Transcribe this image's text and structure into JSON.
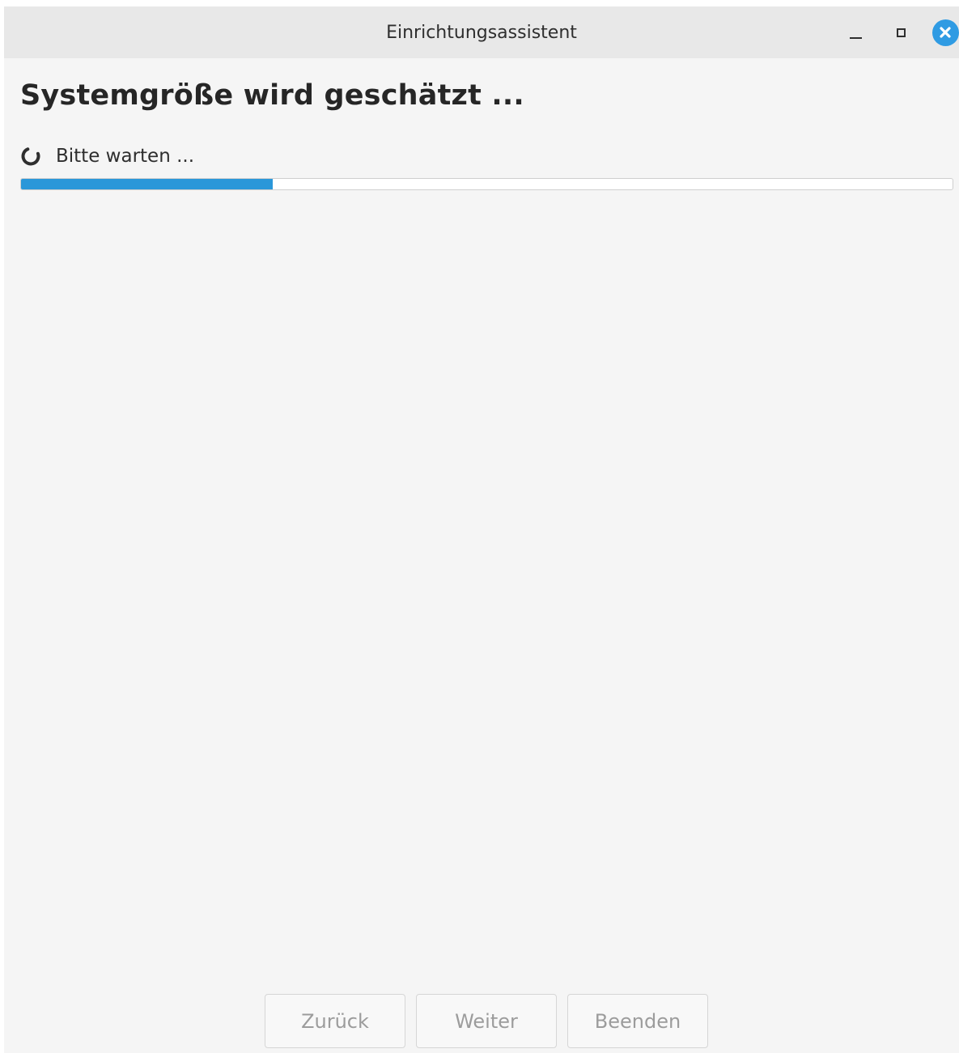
{
  "window": {
    "title": "Einrichtungsassistent",
    "controls": {
      "minimize": "minimize-icon",
      "maximize": "maximize-icon",
      "close": "close-icon"
    }
  },
  "page": {
    "heading": "Systemgröße wird geschätzt ...",
    "status": {
      "icon": "spinner-icon",
      "text": "Bitte warten ..."
    },
    "progress": {
      "fraction": 0.27
    }
  },
  "footer": {
    "buttons": {
      "back": "Zurück",
      "next": "Weiter",
      "finish": "Beenden"
    }
  },
  "colors": {
    "accent": "#2a97d9",
    "close_button": "#2f9be3",
    "background": "#f5f5f5",
    "titlebar": "#e8e8e8",
    "disabled_text": "#9c9c9c"
  }
}
